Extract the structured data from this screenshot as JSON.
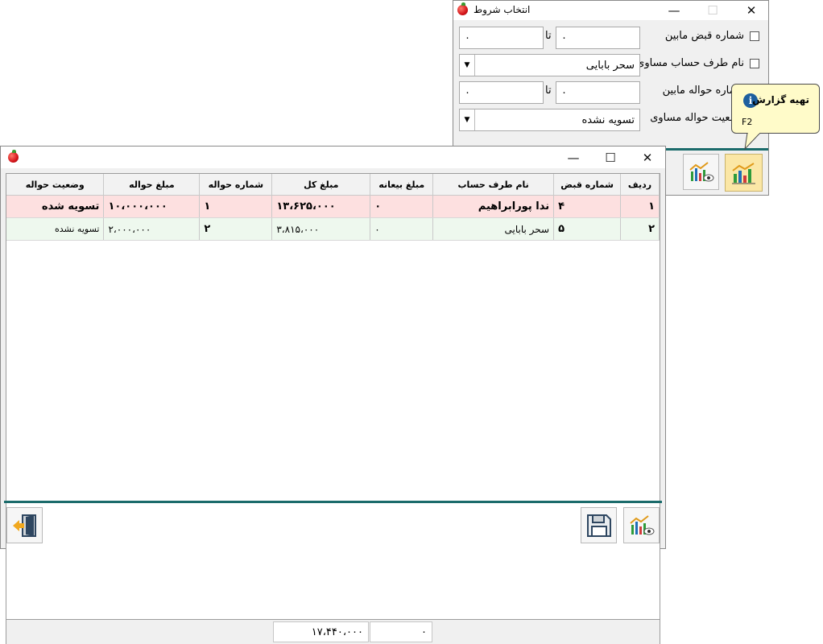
{
  "conditions_window": {
    "title": "انتخاب شروط",
    "receipt_range_label": "شماره قبض مابین",
    "receipt_from": "۰",
    "to_label_1": "تا",
    "receipt_to": "۰",
    "account_label": "نام طرف حساب مساوی",
    "account_value": "سحر بابایی",
    "transfer_range_label": "شماره حواله مابین",
    "transfer_from": "۰",
    "to_label_2": "تا",
    "transfer_to": "۰",
    "status_label": "وضعیت حواله مساوی",
    "status_value": "تسویه نشده"
  },
  "tooltip": {
    "title": "تهیه گزارش",
    "shortcut": "F2"
  },
  "report_window": {
    "columns": [
      "ردیف",
      "شماره قبض",
      "نام طرف حساب",
      "مبلغ بیعانه",
      "مبلغ کل",
      "شماره حواله",
      "مبلغ حواله",
      "وضعیت حواله"
    ],
    "rows": [
      {
        "row": "۱",
        "receipt": "۴",
        "account": "ندا پورابراهیم",
        "deposit": "۰",
        "total": "۱۳،۶۲۵،۰۰۰",
        "transfer_no": "۱",
        "transfer_amount": "۱۰،۰۰۰،۰۰۰",
        "status": "تسویه شده"
      },
      {
        "row": "۲",
        "receipt": "۵",
        "account": "سحر بابایی",
        "deposit": "۰",
        "total": "۳،۸۱۵،۰۰۰",
        "transfer_no": "۲",
        "transfer_amount": "۲،۰۰۰،۰۰۰",
        "status": "تسویه نشده"
      }
    ],
    "footer": {
      "deposit_sum": "۰",
      "total_sum": "۱۷،۴۴۰،۰۰۰"
    }
  },
  "colors": {
    "selected_row": "#fde0e0",
    "alt_row": "#eef8ee",
    "accent_line": "#1b6b6b",
    "tooltip_bg": "#fffbc9"
  }
}
